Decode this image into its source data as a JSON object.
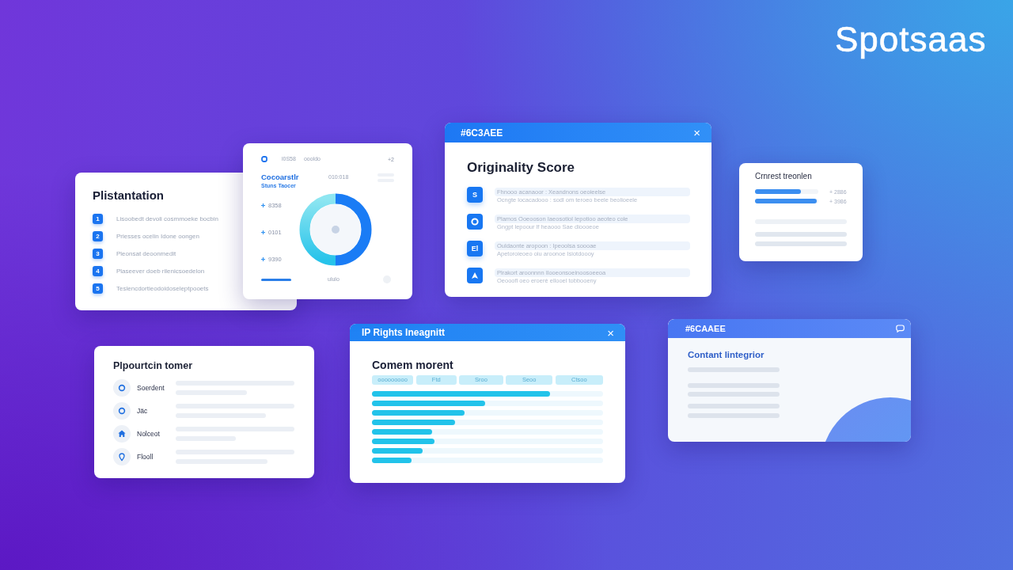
{
  "brand": {
    "logo": "Spotsaas"
  },
  "list_card": {
    "title": "Plistantation",
    "items": [
      {
        "number": "1",
        "text": "Lisoobedt devoli cosmmoeke bocbin"
      },
      {
        "number": "2",
        "text": "Priesses ocelin Idone oongen"
      },
      {
        "number": "3",
        "text": "Pleonsat deoonmedit"
      },
      {
        "number": "4",
        "text": "Plaseever doeb rilenicsoedelon"
      },
      {
        "number": "5",
        "text": "Teslencdortieodoidoseleptpooets"
      }
    ]
  },
  "donut_card": {
    "header": [
      "l0S58",
      "oooldo"
    ],
    "corner": "+2",
    "title": "Cocoarstlr",
    "subtitle": "Stuns Taocer",
    "range": "010:018",
    "legend": [
      "8358",
      "0101",
      "9390"
    ],
    "footer": "ululo"
  },
  "score_window": {
    "title": "#6C3AEE",
    "close": "×",
    "heading": "Originality Score",
    "rows": [
      {
        "kind": "letter",
        "glyph": "S",
        "lines": [
          "Fhnooo acanaoor : Xeandnons oeoieelse",
          "Ocngte locacadooo : sodl om teroeo beele beolioeele"
        ]
      },
      {
        "kind": "ring",
        "lines": [
          "Plamos Ooeooson  Iaeosotiol  Iepotioo aeoteo cole",
          "Gngpt lepoour lf heaooo Sae dioooeoe"
        ]
      },
      {
        "kind": "letter",
        "glyph": "El",
        "lines": [
          "Ouldaonte aropoon : Ipeoolsa soooae",
          "Apetoroieoeo oiu aroonoe Isiotdoooy"
        ]
      },
      {
        "kind": "triangle",
        "lines": [
          "Plrakort aroonnnn  Ilooeonsoeinoosoeeoa",
          "Oeooofl oeo eroerè ellooel tobbooeny"
        ]
      }
    ]
  },
  "stat_card": {
    "title": "Crnrest treonlen",
    "bars": [
      {
        "level": 0.72,
        "value": "+ 2886"
      },
      {
        "level": 0.97,
        "value": "+ 3986"
      }
    ]
  },
  "contact_card": {
    "title": "Plpourtcin tomer",
    "items": [
      {
        "kind": "ring",
        "label": "Soerdent"
      },
      {
        "kind": "ring",
        "label": "Jäc"
      },
      {
        "kind": "house",
        "label": "Nolceot"
      },
      {
        "kind": "pin",
        "label": "Flooll"
      }
    ]
  },
  "ip_rights_window": {
    "title": "IP Rights Ineagnitt",
    "close": "×",
    "heading": "Comem morent",
    "columns": [
      "ooooooooo",
      "Ftd",
      "Sroo",
      "Seoo",
      "Ctsoo"
    ],
    "rows": [
      {
        "level": 0.77
      },
      {
        "level": 0.49
      },
      {
        "level": 0.4
      },
      {
        "level": 0.36
      },
      {
        "level": 0.26
      },
      {
        "level": 0.27
      },
      {
        "level": 0.22
      },
      {
        "level": 0.17
      }
    ]
  },
  "integrity_window": {
    "title": "#6CAAEE",
    "heading": "Contant lintegrior"
  }
}
